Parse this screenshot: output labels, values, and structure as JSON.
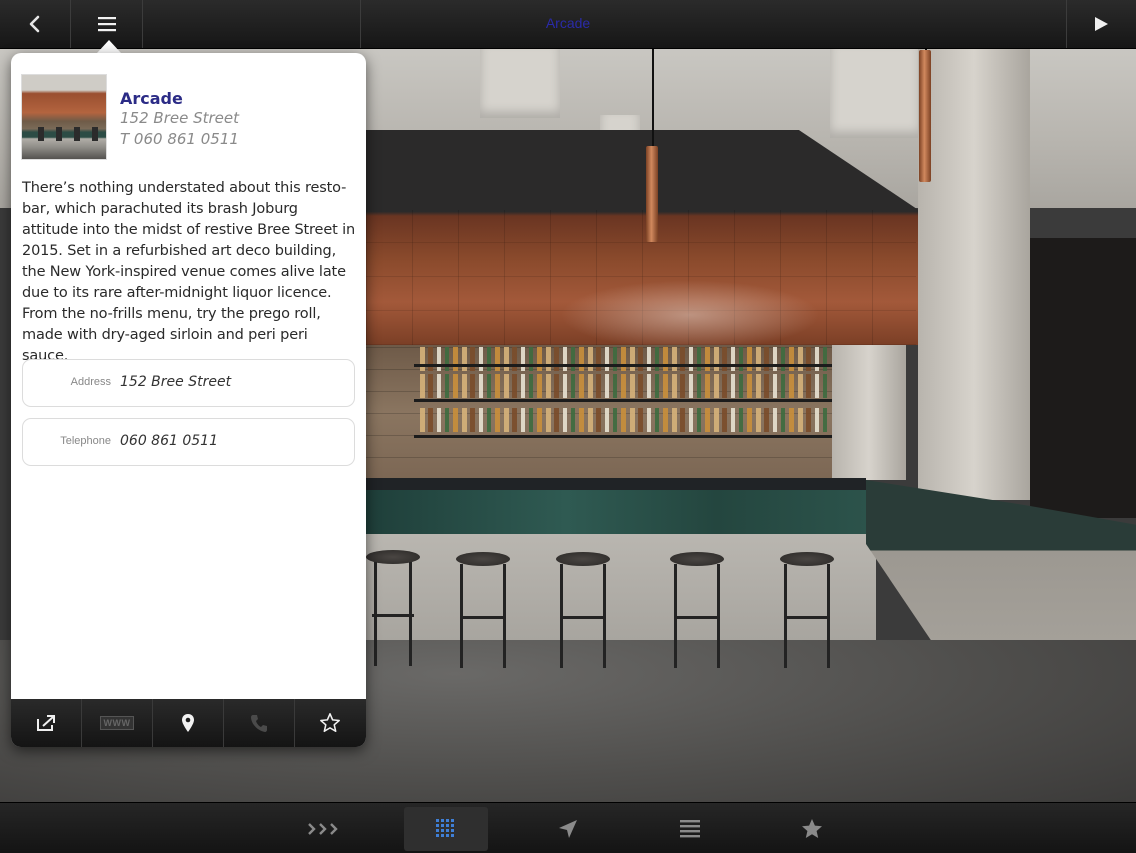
{
  "topbar": {
    "title": "Arcade",
    "back_icon": "chevron-left-icon",
    "menu_icon": "list-icon",
    "play_icon": "play-icon"
  },
  "venue": {
    "name": "Arcade",
    "address_line": "152 Bree Street",
    "phone_line": "T 060 861 0511",
    "description": "There’s nothing understated about this resto-bar, which parachuted its brash Joburg attitude into the midst of restive Bree Street in 2015. Set in a refurbished art deco building, the New York-inspired venue comes alive late due to its rare after-midnight liquor licence. From the no-frills menu, try the prego roll, made with dry-aged sirloin and peri peri sauce."
  },
  "fields": {
    "address": {
      "label": "Address",
      "value": "152 Bree Street"
    },
    "telephone": {
      "label": "Telephone",
      "value": "060 861 0511"
    }
  },
  "actions": {
    "share_icon": "share-icon",
    "www_label": "WWW",
    "map_icon": "map-pin-icon",
    "phone_icon": "phone-icon",
    "favorite_icon": "star-outline-icon"
  },
  "bottombar": {
    "items": [
      {
        "icon": "chevrons-right-icon",
        "glyph": "›››"
      },
      {
        "icon": "grid-icon",
        "active": true
      },
      {
        "icon": "navigation-arrow-icon"
      },
      {
        "icon": "list-lines-icon"
      },
      {
        "icon": "star-icon",
        "glyph": "★"
      }
    ]
  },
  "colors": {
    "title_link": "#2a2aa8",
    "venue_name": "#2b2b86",
    "bar_background": "#1c1c1c"
  }
}
